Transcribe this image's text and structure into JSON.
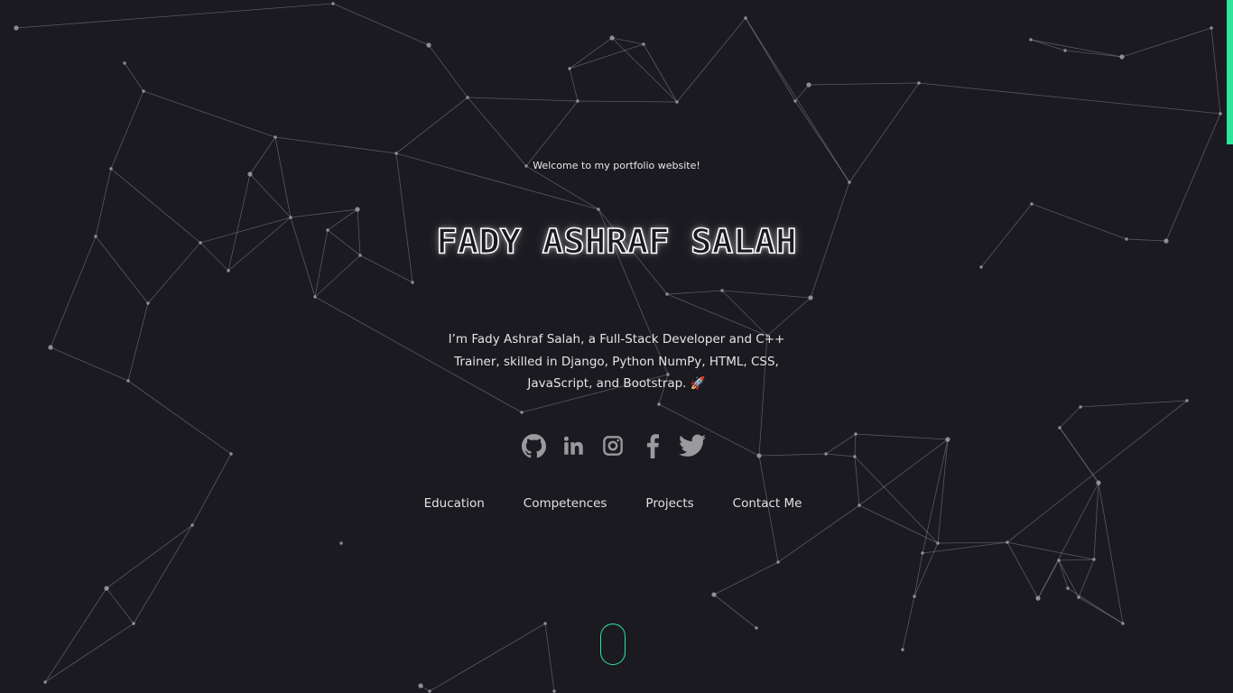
{
  "header": {
    "welcome": "Welcome to my portfolio website!",
    "title": "FADY ASHRAF SALAH"
  },
  "bio": {
    "line1": "I’m Fady Ashraf Salah, a Full-Stack Developer and C++",
    "line2": "Trainer, skilled in Django, Python NumPy, HTML, CSS,",
    "line3": "JavaScript, and Bootstrap. 🚀"
  },
  "socials": [
    {
      "icon": "github-icon"
    },
    {
      "icon": "linkedin-icon"
    },
    {
      "icon": "instagram-icon"
    },
    {
      "icon": "facebook-icon"
    },
    {
      "icon": "twitter-icon"
    }
  ],
  "nav": {
    "education": "Education",
    "competences": "Competences",
    "projects": "Projects",
    "contact": "Contact Me"
  },
  "colors": {
    "background": "#1b1a20",
    "accent": "#2ee59d",
    "icon": "#9a9a9e",
    "network": "#8a8a90"
  }
}
